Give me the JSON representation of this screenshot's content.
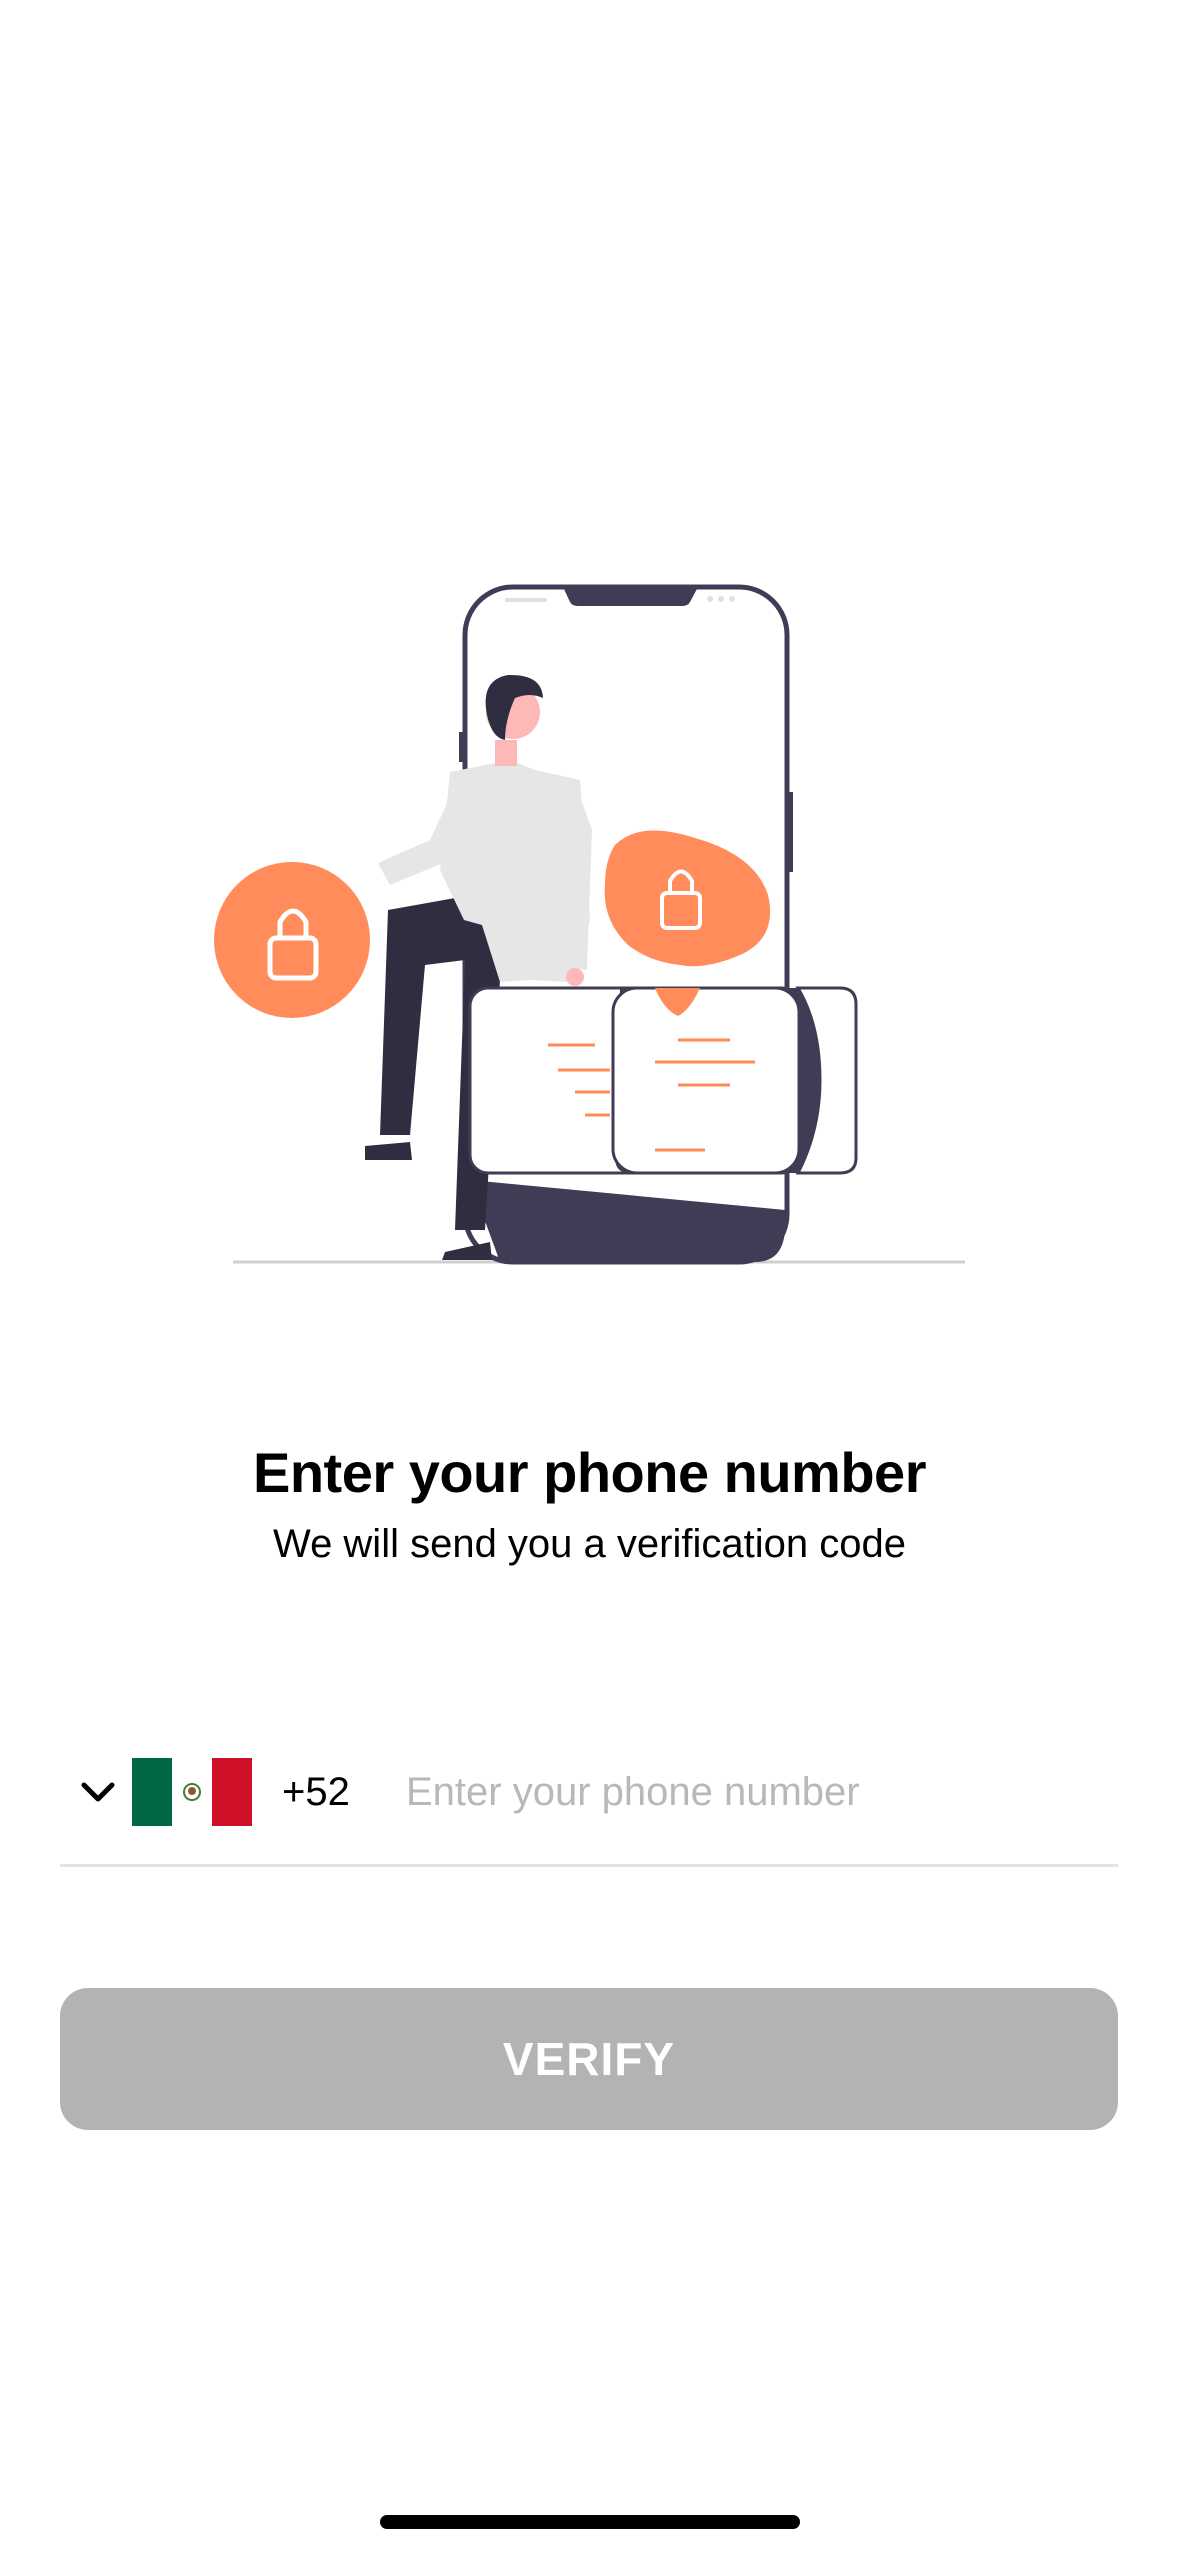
{
  "screen": {
    "title": "Enter your phone number",
    "subtitle": "We will send you a verification code"
  },
  "illustration": {
    "name": "phone-security-illustration",
    "accent_color": "#ff8c5a",
    "dark_color": "#3f3d56"
  },
  "phone_field": {
    "country_flag": "mexico-flag-icon",
    "dial_code": "+52",
    "value": "",
    "placeholder": "Enter your phone number"
  },
  "actions": {
    "verify_label": "VERIFY",
    "verify_color": "#b3b3b3",
    "verify_enabled": false
  }
}
